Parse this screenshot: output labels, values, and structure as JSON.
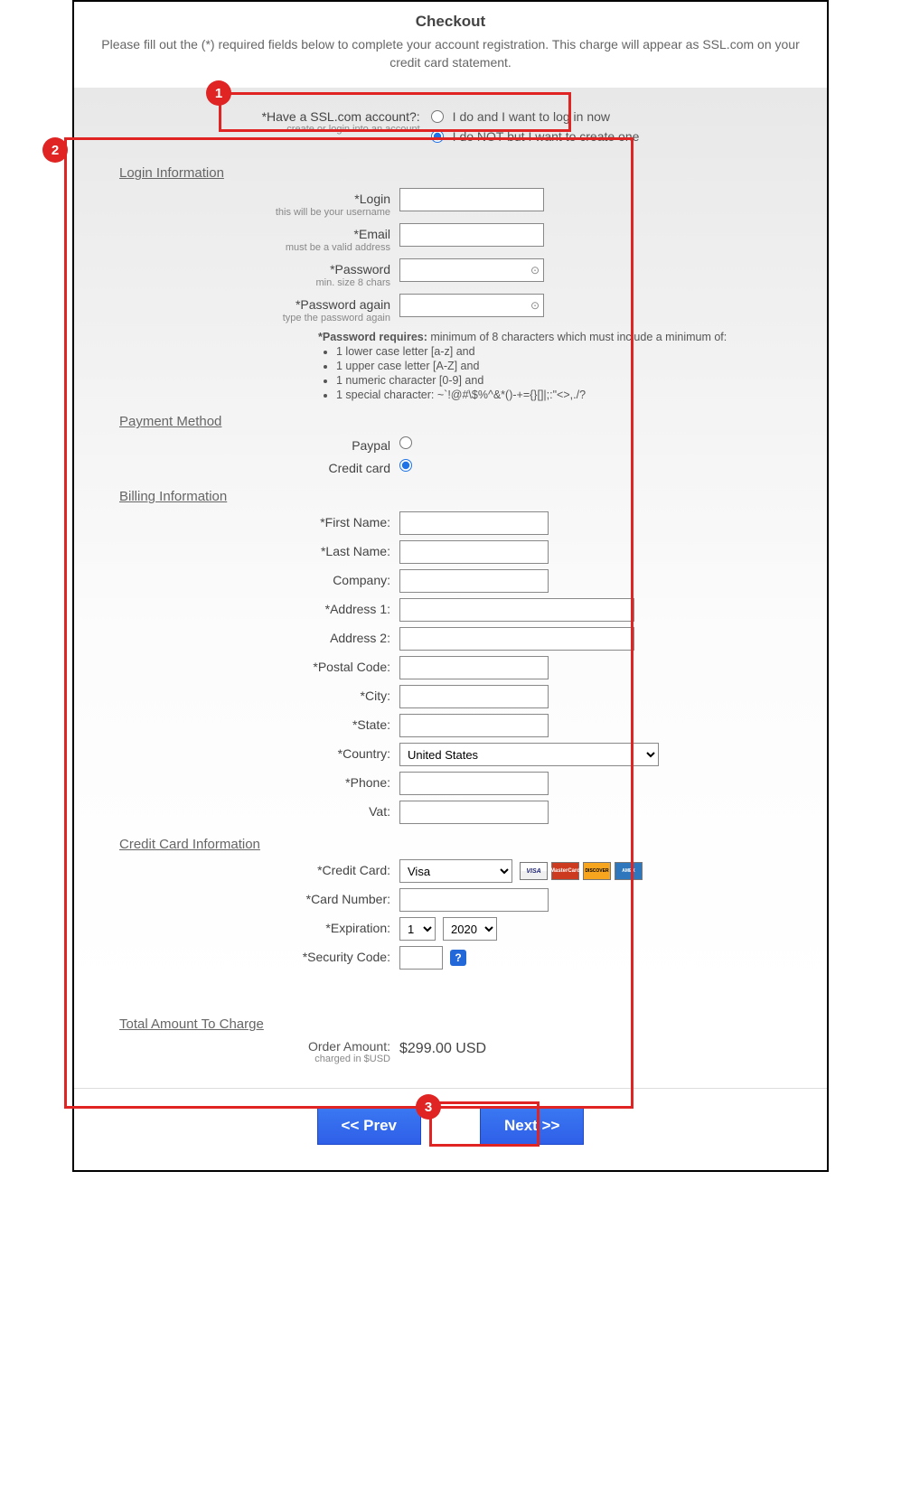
{
  "header": {
    "title": "Checkout",
    "subtitle": "Please fill out the (*) required fields below to complete your account registration. This charge will appear as SSL.com on your credit card statement."
  },
  "badges": {
    "b1": "1",
    "b2": "2",
    "b3": "3"
  },
  "account": {
    "label": "*Have a SSL.com account?:",
    "sublabel": "create or login into an account",
    "opt1": "I do and I want to log in now",
    "opt2": "I do NOT but I want to create one"
  },
  "sections": {
    "login_info": "Login Information",
    "payment_method": "Payment Method",
    "billing_info": "Billing Information",
    "cc_info": "Credit Card Information",
    "total": "Total Amount To Charge"
  },
  "login": {
    "login_label": "*Login",
    "login_sub": "this will be your username",
    "email_label": "*Email",
    "email_sub": "must be a valid address",
    "password_label": "*Password",
    "password_sub": "min. size 8 chars",
    "password_again_label": "*Password again",
    "password_again_sub": "type the password again",
    "pw_req_heading": "*Password requires:",
    "pw_req_lead": " minimum of 8 characters which must include a minimum of:",
    "pw_req1": "1 lower case letter [a-z] and",
    "pw_req2": "1 upper case letter [A-Z] and",
    "pw_req3": "1 numeric character [0-9] and",
    "pw_req4": "1 special character: ~`!@#\\$%^&*()-+={}[]|;:\"<>,./?"
  },
  "payment": {
    "paypal": "Paypal",
    "credit_card": "Credit card"
  },
  "billing": {
    "first_name": "*First Name:",
    "last_name": "*Last Name:",
    "company": "Company:",
    "address1": "*Address 1:",
    "address2": "Address 2:",
    "postal": "*Postal Code:",
    "city": "*City:",
    "state": "*State:",
    "country": "*Country:",
    "country_val": "United States",
    "phone": "*Phone:",
    "vat": "Vat:"
  },
  "cc": {
    "card_label": "*Credit Card:",
    "card_val": "Visa",
    "number_label": "*Card Number:",
    "exp_label": "*Expiration:",
    "exp_month": "1",
    "exp_year": "2020",
    "sec_label": "*Security Code:",
    "icons": {
      "visa": "VISA",
      "mc": "MasterCard",
      "disc": "DISCOVER",
      "amex": "AMEX"
    }
  },
  "totals": {
    "order_label": "Order Amount:",
    "order_sub": "charged in $USD",
    "order_value": "$299.00 USD"
  },
  "buttons": {
    "prev": "<< Prev",
    "next": "Next >>"
  }
}
